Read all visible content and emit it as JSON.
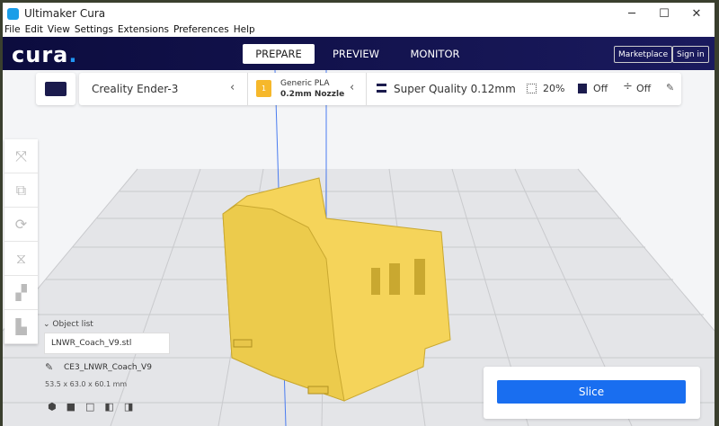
{
  "window": {
    "title": "Ultimaker Cura",
    "min": "─",
    "max": "☐",
    "close": "✕"
  },
  "menu": [
    "File",
    "Edit",
    "View",
    "Settings",
    "Extensions",
    "Preferences",
    "Help"
  ],
  "header": {
    "brand": "cura",
    "tabs": [
      "PREPARE",
      "PREVIEW",
      "MONITOR"
    ],
    "marketplace": "Marketplace",
    "sign_in": "Sign in"
  },
  "toolbar": {
    "printer": "Creality Ender-3",
    "material": "Generic PLA",
    "nozzle": "0.2mm Nozzle",
    "extruder_number": "1",
    "profile": "Super Quality 0.12mm",
    "infill": "20%",
    "support": "Off",
    "adhesion": "Off"
  },
  "object_list": {
    "title": "Object list",
    "file": "LNWR_Coach_V9.stl",
    "job_name": "CE3_LNWR_Coach_V9",
    "dimensions": "53.5 x 63.0 x 60.1 mm"
  },
  "slice": {
    "label": "Slice"
  },
  "colors": {
    "accent": "#196ef0",
    "header": "#0c0c3e",
    "model": "#f5d45a"
  }
}
